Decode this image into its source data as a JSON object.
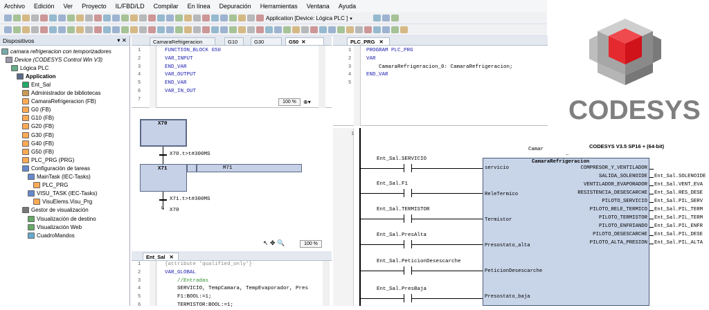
{
  "menu": [
    "Archivo",
    "Edición",
    "Ver",
    "Proyecto",
    "IL/FBD/LD",
    "Compilar",
    "En línea",
    "Depuración",
    "Herramientas",
    "Ventana",
    "Ayuda"
  ],
  "toolbar": {
    "application_label": "Application [Device: Lógica PLC ]"
  },
  "devices_panel": {
    "title": "Dispositivos",
    "tree": [
      {
        "label": "camara refrigeracion con temporizadores",
        "italic": true
      },
      {
        "label": "Device (CODESYS Control Win V3)",
        "italic": true
      },
      {
        "label": "Lógica PLC"
      },
      {
        "label": "Application",
        "bold": true
      },
      {
        "label": "Ent_Sal"
      },
      {
        "label": "Administrador de bibliotecas"
      },
      {
        "label": "CamaraRefrigeracion (FB)"
      },
      {
        "label": "G0 (FB)"
      },
      {
        "label": "G10 (FB)"
      },
      {
        "label": "G20 (FB)"
      },
      {
        "label": "G30 (FB)"
      },
      {
        "label": "G40 (FB)"
      },
      {
        "label": "G50 (FB)"
      },
      {
        "label": "PLC_PRG (PRG)"
      },
      {
        "label": "Configuración de tareas"
      },
      {
        "label": "MainTask (IEC-Tasks)"
      },
      {
        "label": "PLC_PRG"
      },
      {
        "label": "VISU_TASK (IEC-Tasks)"
      },
      {
        "label": "VisuElems.Visu_Prg"
      },
      {
        "label": "Gestor de visualización"
      },
      {
        "label": "Visualización de destino"
      },
      {
        "label": "Visualización Web"
      },
      {
        "label": "CuadroMandos"
      }
    ]
  },
  "editor_g50": {
    "tabs": [
      "CamaraRefrigeracion",
      "G10",
      "G30",
      "G50"
    ],
    "lines": [
      "FUNCTION_BLOCK G50",
      "VAR_INPUT",
      "END_VAR",
      "VAR_OUTPUT",
      "",
      "END_VAR",
      "VAR_IN_OUT"
    ],
    "line_numbers": [
      "1",
      "2",
      "3",
      "4",
      "5",
      "6",
      "7"
    ],
    "zoom": "100 %",
    "sfc": {
      "step1": "X70",
      "trans1": "X70.t>t#300MS",
      "step2": "X71",
      "action_qualifier": "N",
      "action_name": "M71",
      "trans2": "X71.t>t#300MS",
      "jump": "X70"
    },
    "zoom2": "100 %"
  },
  "editor_entsal": {
    "tab": "Ent_Sal",
    "lines": [
      "{attribute 'qualified_only'}",
      "VAR_GLOBAL",
      "    //Entradas",
      "    SERVICIO, TempCamara, TempEvaporador, Pres",
      "    F1:BOOL:=1;",
      "    TERMISTOR:BOOL:=1;"
    ],
    "line_numbers": [
      "1",
      "2",
      "3",
      "4",
      "5",
      "6"
    ]
  },
  "editor_plc_prg": {
    "tab": "PLC_PRG",
    "lines": [
      "PROGRAM PLC_PRG",
      "VAR",
      "",
      "    CamaraRefrigeracion_0: CamaraRefrigeracion;",
      "END_VAR"
    ],
    "line_numbers": [
      "1",
      "2",
      "3",
      "4",
      "5"
    ],
    "network_number": "1",
    "block": {
      "instance": "Camar",
      "instance_underscore": "_",
      "type": "CamaraRefrigeracion",
      "inputs": [
        "servicio",
        "ReleTermico",
        "Termistor",
        "Presostato_alta",
        "PeticionDesescarche",
        "Presostato_baja"
      ],
      "outputs": [
        "COMPRESOR_Y_VENTILADOR",
        "SALIDA_SOLENOIDE",
        "VENTILADOR_EVAPORADOR",
        "RESISTENCIA_DESESCARCHE",
        "PILOTO_SERVICIO",
        "PILOTO_RELE_TERMICO",
        "PILOTO_TERMISTOR",
        "PILOTO_ENFRIANDO",
        "PILOTO_DESESCARCHE",
        "PILOTO_ALTA_PRESION"
      ]
    },
    "contacts": [
      "Ent_Sal.SERVICIO",
      "Ent_Sal.F1",
      "Ent_Sal.TERMISTOR",
      "Ent_Sal.PresAlta",
      "Ent_Sal.PeticionDesescarche",
      "Ent_Sal.PresBaja"
    ],
    "output_vars": [
      "Ent_Sal.SOLENOIDE",
      "Ent_Sal.VENT_EVA",
      "Ent_Sal.RES_DESE",
      "Ent_Sal.PIL_SERV",
      "Ent_Sal.PIL_TERM",
      "Ent_Sal.PIL_TERM",
      "Ent_Sal.PIL_ENFR",
      "Ent_Sal.PIL_DESE",
      "Ent_Sal.PIL_ALTA"
    ]
  },
  "logo": {
    "text": "CODESYS",
    "version": "CODESYS V3.5 SP16 + (64-bit)"
  },
  "colors": {
    "logo_red": "#d0121b",
    "logo_gray": "#8a8a8a",
    "block_fill": "#c8d4e8",
    "sfc_fill": "#c6d0e6"
  }
}
